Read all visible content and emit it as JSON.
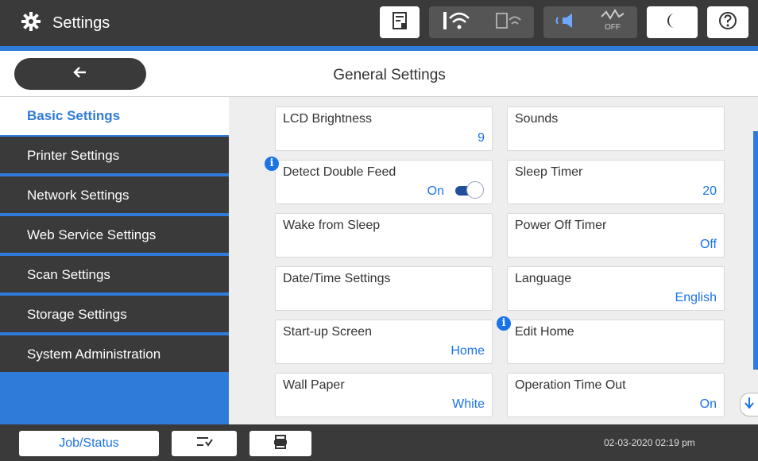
{
  "topbar": {
    "title": "Settings",
    "icons": [
      "gear-icon",
      "document-icon",
      "wifi-icon",
      "wifi-direct-icon",
      "sound-icon",
      "eco-off-icon",
      "moon-icon",
      "help-icon"
    ],
    "eco_label": "OFF"
  },
  "header": {
    "back_icon": "arrow-left-icon",
    "title": "General Settings"
  },
  "sidebar": {
    "items": [
      {
        "label": "Basic Settings",
        "active": true
      },
      {
        "label": "Printer Settings",
        "active": false
      },
      {
        "label": "Network Settings",
        "active": false
      },
      {
        "label": "Web Service Settings",
        "active": false
      },
      {
        "label": "Scan Settings",
        "active": false
      },
      {
        "label": "Storage Settings",
        "active": false
      },
      {
        "label": "System Administration",
        "active": false
      }
    ]
  },
  "settings": {
    "lcd_brightness": {
      "label": "LCD Brightness",
      "value": "9"
    },
    "sounds": {
      "label": "Sounds",
      "value": ""
    },
    "detect_double_feed": {
      "label": "Detect Double Feed",
      "value": "On",
      "toggle_on": true
    },
    "sleep_timer": {
      "label": "Sleep Timer",
      "value": "20"
    },
    "wake_from_sleep": {
      "label": "Wake from Sleep",
      "value": ""
    },
    "power_off_timer": {
      "label": "Power Off Timer",
      "value": "Off"
    },
    "date_time_settings": {
      "label": "Date/Time Settings",
      "value": ""
    },
    "language": {
      "label": "Language",
      "value": "English"
    },
    "startup_screen": {
      "label": "Start-up Screen",
      "value": "Home"
    },
    "edit_home": {
      "label": "Edit Home",
      "value": ""
    },
    "wall_paper": {
      "label": "Wall Paper",
      "value": "White"
    },
    "operation_time_out": {
      "label": "Operation Time Out",
      "value": "On"
    }
  },
  "bottombar": {
    "job_status_label": "Job/Status",
    "datetime": "02-03-2020 02:19 pm"
  },
  "colors": {
    "accent": "#2f7bd9",
    "dark": "#3a3a3a",
    "value_text": "#1a73e8"
  }
}
